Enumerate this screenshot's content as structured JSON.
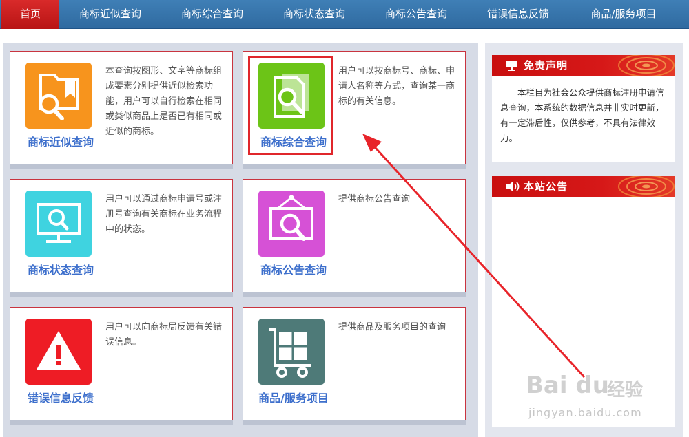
{
  "nav": {
    "items": [
      {
        "label": "首页",
        "active": true
      },
      {
        "label": "商标近似查询"
      },
      {
        "label": "商标综合查询"
      },
      {
        "label": "商标状态查询"
      },
      {
        "label": "商标公告查询"
      },
      {
        "label": "错误信息反馈"
      },
      {
        "label": "商品/服务项目"
      }
    ]
  },
  "cards": [
    {
      "title": "商标近似查询",
      "icon": "folder-search-icon",
      "color": "#f7941d",
      "desc": "本查询按图形、文字等商标组成要素分别提供近似检索功能，用户可以自行检索在相同或类似商品上是否已有相同或近似的商标。"
    },
    {
      "title": "商标综合查询",
      "icon": "document-search-icon",
      "color": "#6cc417",
      "highlighted": true,
      "desc": "用户可以按商标号、商标、申请人名称等方式，查询某一商标的有关信息。"
    },
    {
      "title": "商标状态查询",
      "icon": "monitor-search-icon",
      "color": "#3fd3e0",
      "desc": "用户可以通过商标申请号或注册号查询有关商标在业务流程中的状态。"
    },
    {
      "title": "商标公告查询",
      "icon": "frame-search-icon",
      "color": "#d651d6",
      "desc": "提供商标公告查询"
    },
    {
      "title": "错误信息反馈",
      "icon": "warning-icon",
      "color": "#ee1c25",
      "desc": "用户可以向商标局反馈有关错误信息。"
    },
    {
      "title": "商品/服务项目",
      "icon": "cart-icon",
      "color": "#4e7a78",
      "desc": "提供商品及服务项目的查询"
    }
  ],
  "sidebar": {
    "disclaimer": {
      "title": "免责声明",
      "icon": "monitor-icon",
      "text": "本栏目为社会公众提供商标注册申请信息查询，本系统的数据信息并非实时更新，有一定滞后性，仅供参考，不具有法律效力。"
    },
    "notice": {
      "title": "本站公告",
      "icon": "speaker-icon"
    }
  },
  "watermark": {
    "brand": "Bai du",
    "brand_cn": "经验",
    "url": "jingyan.baidu.com"
  },
  "colors": {
    "nav_bg": "#2f6aa0",
    "nav_active": "#c81a1a",
    "card_border": "#c9343f",
    "card_title": "#3d6fcc",
    "highlight": "#e0262b",
    "sidebar_header": "#c90f0f"
  }
}
